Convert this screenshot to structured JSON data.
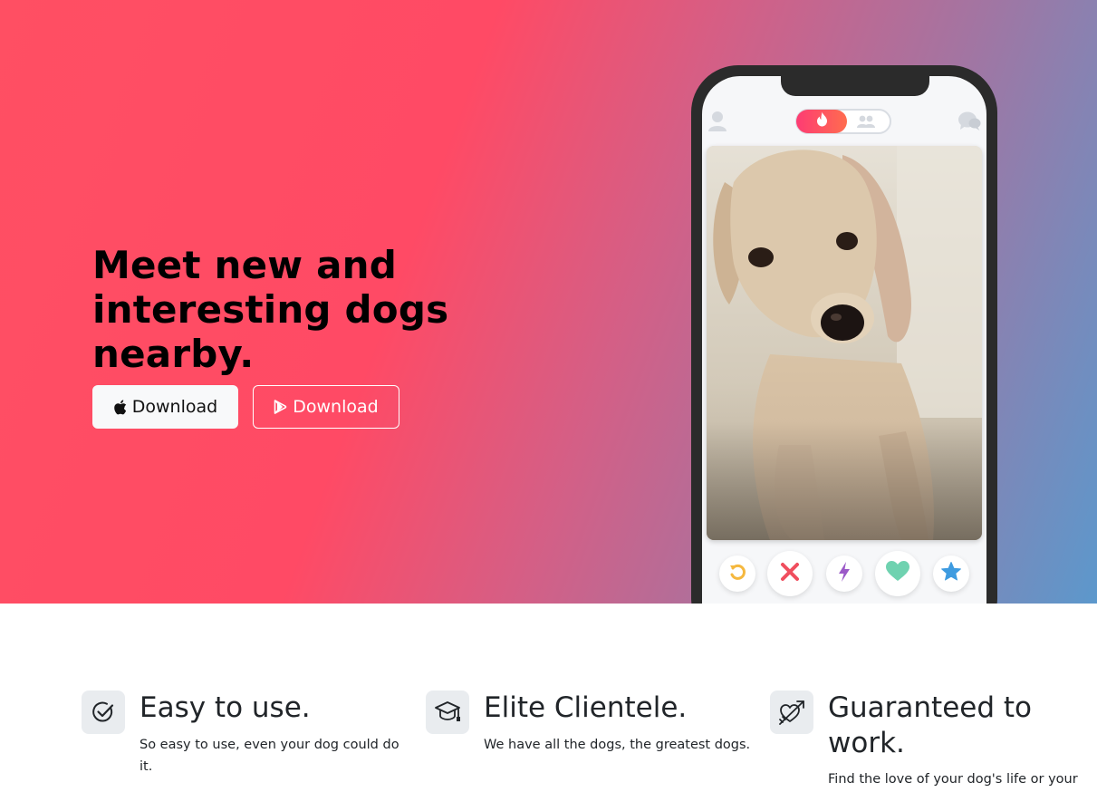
{
  "hero": {
    "title": "Meet new and interesting dogs nearby.",
    "apple_button": "Download",
    "play_button": "Download"
  },
  "phone": {
    "actions": [
      "rewind",
      "nope",
      "boost",
      "like",
      "super-like"
    ],
    "colors": {
      "rewind": "#f5b83f",
      "nope": "#f04e5e",
      "boost": "#9b59c8",
      "like": "#6fd2b0",
      "super_like": "#3e9be0"
    }
  },
  "features": [
    {
      "icon": "circle-check-icon",
      "title": "Easy to use.",
      "description": "So easy to use, even your dog could do it."
    },
    {
      "icon": "graduation-cap-icon",
      "title": "Elite Clientele.",
      "description": "We have all the dogs, the greatest dogs."
    },
    {
      "icon": "heart-arrow-icon",
      "title": "Guaranteed to work.",
      "description": "Find the love of your dog's life or your"
    }
  ],
  "colors": {
    "gradient_start": "#ff4f63",
    "gradient_mid": "#d45f86",
    "gradient_end": "#5c98cc"
  }
}
